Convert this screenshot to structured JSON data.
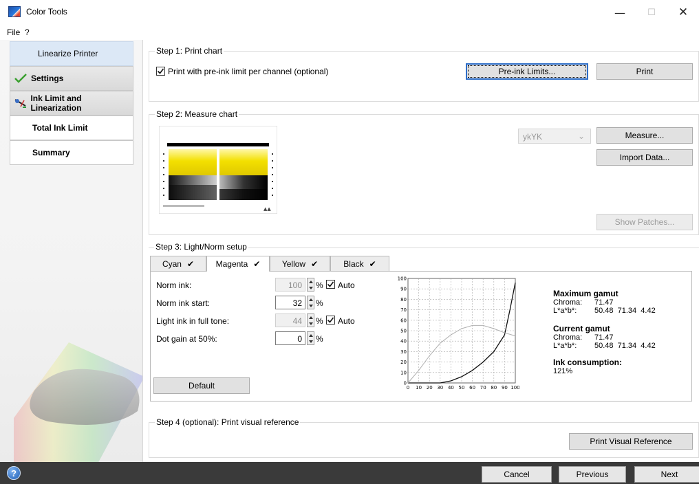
{
  "window": {
    "title": "Color Tools",
    "minimize": "—",
    "maximize": "☐",
    "close": "✕"
  },
  "menu": {
    "file": "File",
    "help": "?"
  },
  "sidebar": {
    "items": [
      {
        "label": "Linearize Printer"
      },
      {
        "label": "Settings"
      },
      {
        "label": "Ink Limit and Linearization"
      },
      {
        "label": "Total Ink Limit"
      },
      {
        "label": "Summary"
      }
    ]
  },
  "step1": {
    "title": "Step 1: Print chart",
    "checkbox_label": "Print with pre-ink limit per channel (optional)",
    "checked": true,
    "pre_ink_button": "Pre-ink Limits...",
    "print_button": "Print"
  },
  "step2": {
    "title": "Step 2: Measure chart",
    "channel_select": "ykYK",
    "measure_button": "Measure...",
    "import_button": "Import Data...",
    "show_patches_button": "Show Patches..."
  },
  "step3": {
    "title": "Step 3: Light/Norm setup",
    "tabs": [
      {
        "label": "Cyan",
        "check": "✔"
      },
      {
        "label": "Magenta",
        "check": "✔"
      },
      {
        "label": "Yellow",
        "check": "✔"
      },
      {
        "label": "Black",
        "check": "✔"
      }
    ],
    "active_tab": "Magenta",
    "norm_ink": {
      "label": "Norm ink:",
      "value": "100",
      "unit": "%",
      "auto_label": "Auto"
    },
    "norm_ink_start": {
      "label": "Norm ink start:",
      "value": "32",
      "unit": "%"
    },
    "light_ink": {
      "label": "Light ink in full tone:",
      "value": "44",
      "unit": "%",
      "auto_label": "Auto"
    },
    "dot_gain": {
      "label": "Dot gain at 50%:",
      "value": "0",
      "unit": "%"
    },
    "default_button": "Default",
    "max_gamut": {
      "title": "Maximum gamut",
      "chroma_label": "Chroma:",
      "chroma": "71.47",
      "lab_label": "L*a*b*:",
      "lab": "50.48  71.34  4.42"
    },
    "current_gamut": {
      "title": "Current gamut",
      "chroma_label": "Chroma:",
      "chroma": "71.47",
      "lab_label": "L*a*b*:",
      "lab": "50.48  71.34  4.42"
    },
    "ink_consumption": {
      "title": "Ink consumption:",
      "value": "121%"
    }
  },
  "chart_data": {
    "type": "line",
    "title": "",
    "xlabel": "",
    "ylabel": "",
    "xlim": [
      0,
      100
    ],
    "ylim": [
      0,
      100
    ],
    "x_ticks": [
      "0",
      "10",
      "20",
      "30",
      "40",
      "50",
      "60",
      "70",
      "80",
      "90",
      "100"
    ],
    "y_ticks": [
      "0",
      "10",
      "20",
      "30",
      "40",
      "50",
      "60",
      "70",
      "80",
      "90",
      "100"
    ],
    "grid": true,
    "series": [
      {
        "color": "#111111",
        "x": [
          0,
          30,
          40,
          50,
          60,
          70,
          80,
          90,
          95,
          100
        ],
        "y": [
          0,
          0,
          2,
          6,
          12,
          20,
          30,
          46,
          70,
          96
        ]
      },
      {
        "color": "#b0b0b0",
        "x": [
          0,
          10,
          20,
          30,
          40,
          50,
          60,
          70,
          80,
          90,
          100
        ],
        "y": [
          0,
          12,
          26,
          38,
          46,
          52,
          55,
          55,
          52,
          48,
          45
        ]
      }
    ]
  },
  "step4": {
    "title": "Step 4 (optional): Print visual reference",
    "button": "Print Visual Reference"
  },
  "footer": {
    "help": "?",
    "cancel": "Cancel",
    "previous": "Previous",
    "next": "Next"
  },
  "colors": {
    "accent": "#2e6ec8",
    "sidebar_active": "#dce8f6",
    "footer_bg": "#3a3a3a",
    "check_green": "#3aa02f"
  }
}
